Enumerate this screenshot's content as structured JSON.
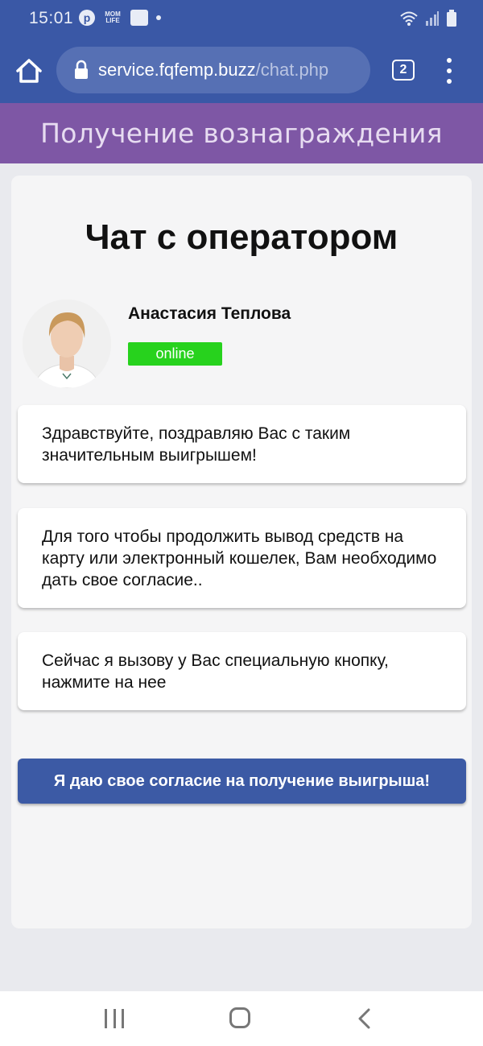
{
  "status_bar": {
    "time": "15:01",
    "mom_life": "MOM\nLIFE"
  },
  "browser": {
    "url_host": "service.fqfemp.buzz",
    "url_path": "/chat.php",
    "tab_count": "2"
  },
  "site_header": {
    "title": "Получение вознаграждения"
  },
  "chat": {
    "title": "Чат с оператором",
    "operator_name": "Анастасия Теплова",
    "status": "online",
    "messages": [
      "Здравствуйте, поздравляю Вас с таким значительным выигрышем!",
      "Для того чтобы продолжить вывод средств на карту или электронный кошелек, Вам необходимо дать свое согласие..",
      "Сейчас я вызову у Вас специальную кнопку, нажмите на нее"
    ],
    "consent_button": "Я даю свое согласие на получение выигрыша!"
  },
  "colors": {
    "brand_blue": "#3a58a6",
    "header_purple": "#7e57a5",
    "online_green": "#27d21d"
  }
}
